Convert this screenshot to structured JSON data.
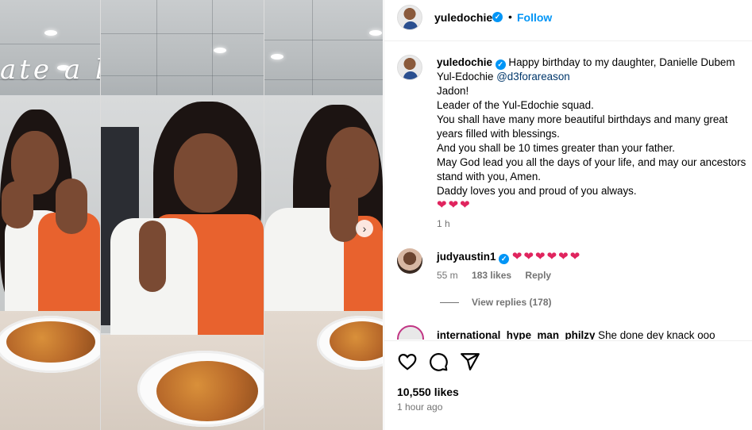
{
  "media": {
    "overlay_text": "ate a lot"
  },
  "header": {
    "username": "yuledochie",
    "verified_icon": "verified-badge-icon",
    "separator": "•",
    "follow_label": "Follow"
  },
  "caption": {
    "username": "yuledochie",
    "first_line": "Happy birthday to my daughter, Danielle Dubem Yul-Edochie",
    "mention": "@d3forareason",
    "lines": [
      "Jadon!",
      "Leader of the Yul-Edochie squad.",
      "You shall have many more beautiful birthdays and many great years filled with blessings.",
      "And you shall be 10 times greater than your father.",
      "May God lead you all the days of your life, and may our ancestors stand with you, Amen.",
      "Daddy loves you and proud of you always."
    ],
    "hearts": "❤❤❤",
    "time": "1 h"
  },
  "comments": [
    {
      "username": "judyaustin1",
      "text": "❤❤❤❤❤❤",
      "time": "55 m",
      "likes": "183 likes",
      "reply_label": "Reply",
      "view_replies": "View replies (178)"
    },
    {
      "username": "international_hype_man_philzy",
      "text": "She done dey knack ooo"
    }
  ],
  "actions": {
    "like_icon": "heart-icon",
    "comment_icon": "comment-icon",
    "share_icon": "share-icon",
    "likes_count": "10,550 likes",
    "posted_time": "1 hour ago"
  },
  "colors": {
    "accent": "#0095f6",
    "heart": "#e0245e",
    "muted": "#737373"
  }
}
